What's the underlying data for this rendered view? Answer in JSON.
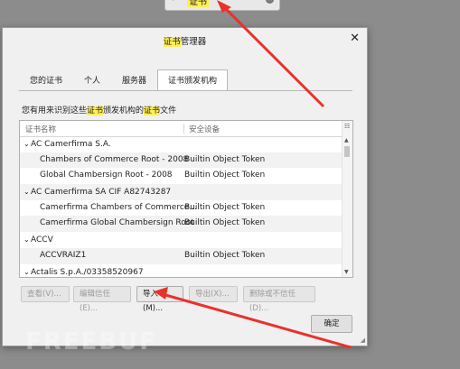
{
  "top_search": {
    "text": "证书",
    "icon": "search-icon"
  },
  "dialog": {
    "title_highlight": "证书",
    "title_rest": "管理器",
    "close_label": "✕"
  },
  "tabs": [
    {
      "label": "您的证书"
    },
    {
      "label": "个人"
    },
    {
      "label": "服务器"
    },
    {
      "label": "证书颁发机构",
      "active": true
    }
  ],
  "description": {
    "part1": "您有用来识别这些",
    "hl1": "证书",
    "part2": "颁发机构的",
    "hl2": "证书",
    "part3": "文件"
  },
  "table": {
    "columns": [
      "证书名称",
      "安全设备"
    ],
    "rows": [
      {
        "type": "group",
        "name": "AC Camerfirma S.A.",
        "device": ""
      },
      {
        "type": "child",
        "name": "Chambers of Commerce Root - 2008",
        "device": "Builtin Object Token"
      },
      {
        "type": "child",
        "name": "Global Chambersign Root - 2008",
        "device": "Builtin Object Token"
      },
      {
        "type": "group",
        "name": "AC Camerfirma SA CIF A82743287",
        "device": ""
      },
      {
        "type": "child",
        "name": "Camerfirma Chambers of Commerce...",
        "device": "Builtin Object Token"
      },
      {
        "type": "child",
        "name": "Camerfirma Global Chambersign Root",
        "device": "Builtin Object Token"
      },
      {
        "type": "group",
        "name": "ACCV",
        "device": ""
      },
      {
        "type": "child",
        "name": "ACCVRAIZ1",
        "device": "Builtin Object Token"
      },
      {
        "type": "group",
        "name": "Actalis S.p.A./03358520967",
        "device": ""
      }
    ]
  },
  "buttons": {
    "view": "查看(V)...",
    "edit_trust": "编辑信任(E)...",
    "import": "导入(M)...",
    "export": "导出(X)...",
    "delete": "删除或不信任(D)...",
    "ok": "确定"
  },
  "watermark": "FREEBUF",
  "colors": {
    "highlight": "#ffee55",
    "arrow": "#e8322c"
  }
}
